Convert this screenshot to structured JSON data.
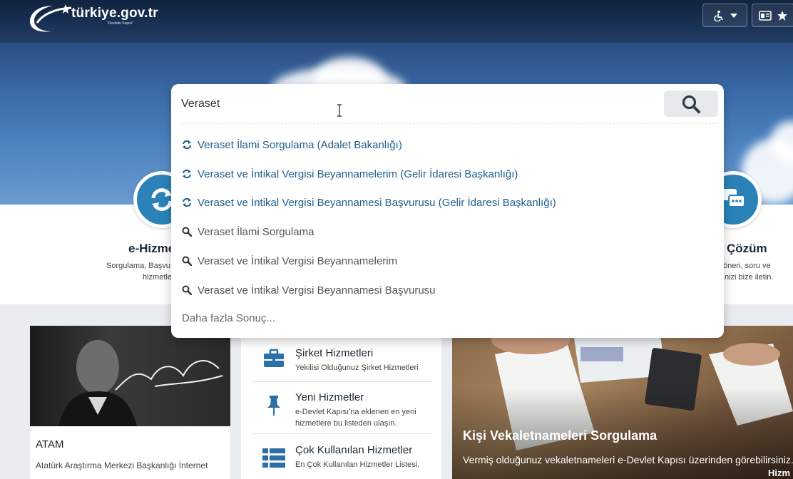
{
  "header": {
    "logo_text": "türkiye.gov.tr",
    "logo_sub": "\"Devletin Kapısı\""
  },
  "search": {
    "value": "Veraset",
    "placeholder": "",
    "suggestions": [
      {
        "type": "service",
        "icon": "refresh-icon",
        "label": "Veraset İlami Sorgulama (Adalet Bakanlığı)"
      },
      {
        "type": "service",
        "icon": "refresh-icon",
        "label": "Veraset ve İntikal Vergisi Beyannamelerim (Gelir İdaresi Başkanlığı)"
      },
      {
        "type": "service",
        "icon": "refresh-icon",
        "label": "Veraset ve İntikal Vergisi Beyannamesi Başvurusu (Gelir İdaresi Başkanlığı)"
      },
      {
        "type": "query",
        "icon": "search-icon",
        "label": "Veraset İlami Sorgulama"
      },
      {
        "type": "query",
        "icon": "search-icon",
        "label": "Veraset ve İntikal Vergisi Beyannamelerim"
      },
      {
        "type": "query",
        "icon": "search-icon",
        "label": "Veraset ve İntikal Vergisi Beyannamesi Başvurusu"
      }
    ],
    "more_label": "Daha fazla Sonuç..."
  },
  "band": {
    "left": {
      "title": "e-Hizme",
      "desc1": "Sorgulama, Başvu",
      "desc2": "hizmetle"
    },
    "right": {
      "title": "Çözüm",
      "desc1": "öneri, soru ve",
      "desc2": "nizi bize iletin."
    }
  },
  "atam": {
    "title": "ATAM",
    "desc": "Atatürk Araştırma Merkezi Başkanlığı İnternet"
  },
  "services": [
    {
      "title": "Şirket Hizmetleri",
      "desc": "Yekilisi Olduğunuz Şirket Hizmetleri",
      "icon": "briefcase-icon"
    },
    {
      "title": "Yeni Hizmetler",
      "desc": "e-Devlet Kapısı'na eklenen en yeni hizmetlere bu listeden ulaşın.",
      "icon": "pin-icon"
    },
    {
      "title": "Çok Kullanılan Hizmetler",
      "desc": "En Çok Kullanılan Hizmetler Listesi.",
      "icon": "list-icon"
    }
  ],
  "feature": {
    "title": "Kişi Vekaletnameleri Sorgulama",
    "desc": "Vermiş olduğunuz vekaletnameleri e-Devlet Kapısı üzerinden görebilirsiniz.",
    "desc_tail": "Hizm"
  },
  "colors": {
    "accent": "#2a82b8",
    "link": "#1f5f8e"
  }
}
